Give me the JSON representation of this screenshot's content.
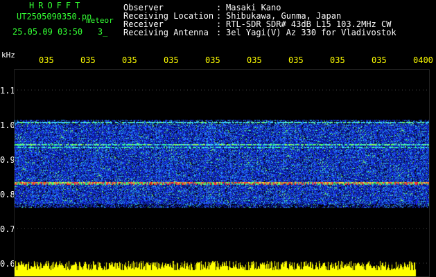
{
  "header": {
    "brand": "HROFFT",
    "filename": "UT2505090350.pn",
    "filename_suffix": "meteor",
    "date": "25.05.09 03:50",
    "count": "3_",
    "fields": [
      {
        "label": "Observer",
        "value": "Masaki Kano"
      },
      {
        "label": "Receiving Location",
        "value": "Shibukawa, Gunma, Japan"
      },
      {
        "label": "Receiver",
        "value": "RTL-SDR SDR# 43dB L15 103.2MHz CW"
      },
      {
        "label": "Receiving Antenna",
        "value": "3el Yagi(V) Az 330 for Vladivostok"
      }
    ]
  },
  "axes": {
    "y_unit": "kHz",
    "y_ticks": [
      "1.1",
      "1.0",
      "0.9",
      "0.8",
      "0.7",
      "0.6"
    ],
    "x_ticks": [
      "035",
      "035",
      "035",
      "035",
      "035",
      "035",
      "035",
      "035",
      "035",
      "0400"
    ]
  },
  "colors": {
    "header_text": "#ffffff",
    "brand_text": "#33ff33",
    "x_tick_text": "#ffff00",
    "background": "#000000",
    "signal_hot": "#ff2020",
    "signal_band": "#2244ff",
    "amplitude": "#ffff00"
  }
}
